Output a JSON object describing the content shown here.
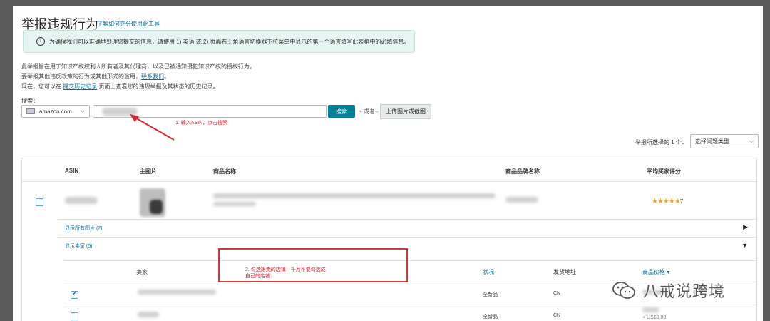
{
  "page": {
    "title": "举报违规行为",
    "title_link": "了解如何充分使用此工具"
  },
  "info": {
    "icon": "info-icon",
    "text": "为确保我们可以准确地处理您提交的信息，请使用 1) 英语 或 2) 页面右上角语言切换器下拉菜单中显示的第一个语言填写此表格中的必填信息。"
  },
  "description": {
    "line1": "此举报旨在用于知识产权权利人所有者及其代理商，以及已被通知侵犯知识产权的授权行为。",
    "line2_prefix": "要举报其他违反政策的行为或其他形式的滥用，",
    "line2_link": "联系我们",
    "line3_prefix": "现在，您可以在",
    "line3_link": "提交历史记录",
    "line3_suffix": "页面上查看您的违规举报及其状态的历史记录。"
  },
  "search": {
    "label": "搜索：",
    "marketplace": "amazon.com",
    "search_button": "搜索",
    "or_text": "- 或者 -",
    "upload_button": "上传图片或截图"
  },
  "annotations": {
    "step1": "1. 输入ASIN，点击搜索",
    "step2_line1": "2. 勾选跟卖的店铺，千万不要勾选成",
    "step2_line2": "自己的店铺"
  },
  "filter": {
    "label": "举报所选择的 1 个：",
    "placeholder": "选择问题类型"
  },
  "table": {
    "headers": [
      "ASIN",
      "主图片",
      "商品名称",
      "商品品牌名称",
      "平均买家评分"
    ],
    "rating_stars": "★★★★★",
    "rating_count": "7",
    "show_all_images": "显示所有图片 (7)",
    "show_sellers": "显示卖家 (5)"
  },
  "sellers": {
    "headers": [
      "卖家",
      "状况",
      "发货地址",
      "商品价格"
    ],
    "rows": [
      {
        "condition": "全新品",
        "ship_from": "CN",
        "price": "",
        "checked": true
      },
      {
        "condition": "全新品",
        "ship_from": "CN",
        "price": "US$0.00",
        "checked": false
      }
    ]
  },
  "watermark": {
    "text": "八戒说跨境",
    "icon": "wechat-icon"
  }
}
